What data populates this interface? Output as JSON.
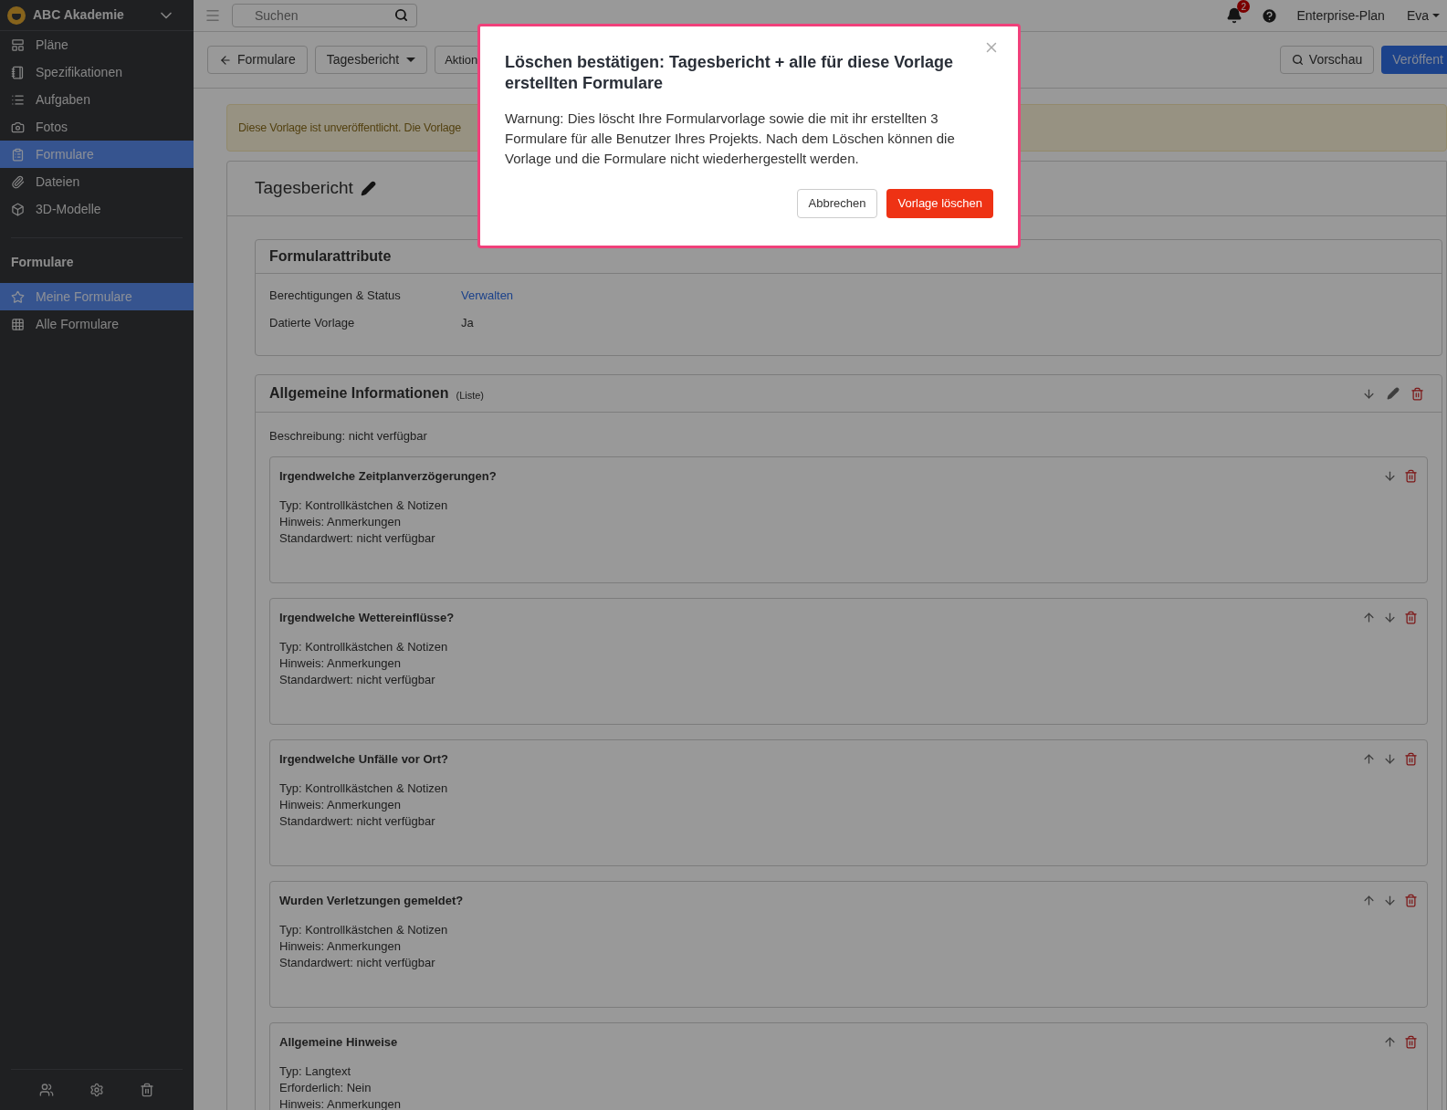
{
  "sidebar": {
    "org": "ABC Akademie",
    "items": [
      {
        "label": "Pläne",
        "selected": false
      },
      {
        "label": "Spezifikationen",
        "selected": false
      },
      {
        "label": "Aufgaben",
        "selected": false
      },
      {
        "label": "Fotos",
        "selected": false
      },
      {
        "label": "Formulare",
        "selected": true
      },
      {
        "label": "Dateien",
        "selected": false
      },
      {
        "label": "3D-Modelle",
        "selected": false
      }
    ],
    "section_title": "Formulare",
    "section_items": [
      {
        "label": "Meine Formulare",
        "selected": true
      },
      {
        "label": "Alle Formulare",
        "selected": false
      }
    ]
  },
  "topbar": {
    "search": {
      "placeholder": "Suchen"
    },
    "notifications": "2",
    "plan": "Enterprise-Plan",
    "user": "Eva"
  },
  "toolbar": {
    "back": "Formulare",
    "template": "Tagesbericht",
    "actions": "Aktion",
    "preview": "Vorschau",
    "publish": "Veröffent"
  },
  "banner": "Diese Vorlage ist unveröffentlicht. Die Vorlage",
  "form": {
    "title": "Tagesbericht",
    "attributes": {
      "title": "Formularattribute",
      "rows": [
        {
          "label": "Berechtigungen & Status",
          "value": "Verwalten",
          "kind": "link"
        },
        {
          "label": "Datierte Vorlage",
          "value": "Ja",
          "kind": "text"
        }
      ]
    },
    "section": {
      "title": "Allgemeine Informationen",
      "type": "(Liste)",
      "description": "Beschreibung: nicht verfügbar",
      "fields": [
        {
          "title": "Irgendwelche Zeitplanverzögerungen?",
          "can_move_up": false,
          "can_move_down": true,
          "lines": [
            "Typ: Kontrollkästchen & Notizen",
            "Hinweis: Anmerkungen",
            "Standardwert: nicht verfügbar"
          ]
        },
        {
          "title": "Irgendwelche Wettereinflüsse?",
          "can_move_up": true,
          "can_move_down": true,
          "lines": [
            "Typ: Kontrollkästchen & Notizen",
            "Hinweis: Anmerkungen",
            "Standardwert: nicht verfügbar"
          ]
        },
        {
          "title": "Irgendwelche Unfälle vor Ort?",
          "can_move_up": true,
          "can_move_down": true,
          "lines": [
            "Typ: Kontrollkästchen & Notizen",
            "Hinweis: Anmerkungen",
            "Standardwert: nicht verfügbar"
          ]
        },
        {
          "title": "Wurden Verletzungen gemeldet?",
          "can_move_up": true,
          "can_move_down": true,
          "lines": [
            "Typ: Kontrollkästchen & Notizen",
            "Hinweis: Anmerkungen",
            "Standardwert: nicht verfügbar"
          ]
        },
        {
          "title": "Allgemeine Hinweise",
          "can_move_up": true,
          "can_move_down": false,
          "lines": [
            "Typ: Langtext",
            "Erforderlich: Nein",
            "Hinweis: Anmerkungen"
          ]
        }
      ]
    }
  },
  "dialog": {
    "title": "Löschen bestätigen: Tagesbericht + alle für diese Vorlage erstellten Formulare",
    "body": "Warnung: Dies löscht Ihre Formularvorlage sowie die mit ihr erstellten 3 Formulare für alle Benutzer Ihres Projekts. Nach dem Löschen können die Vorlage und die Formulare nicht wiederhergestellt werden.",
    "cancel": "Abbrechen",
    "confirm": "Vorlage löschen"
  }
}
